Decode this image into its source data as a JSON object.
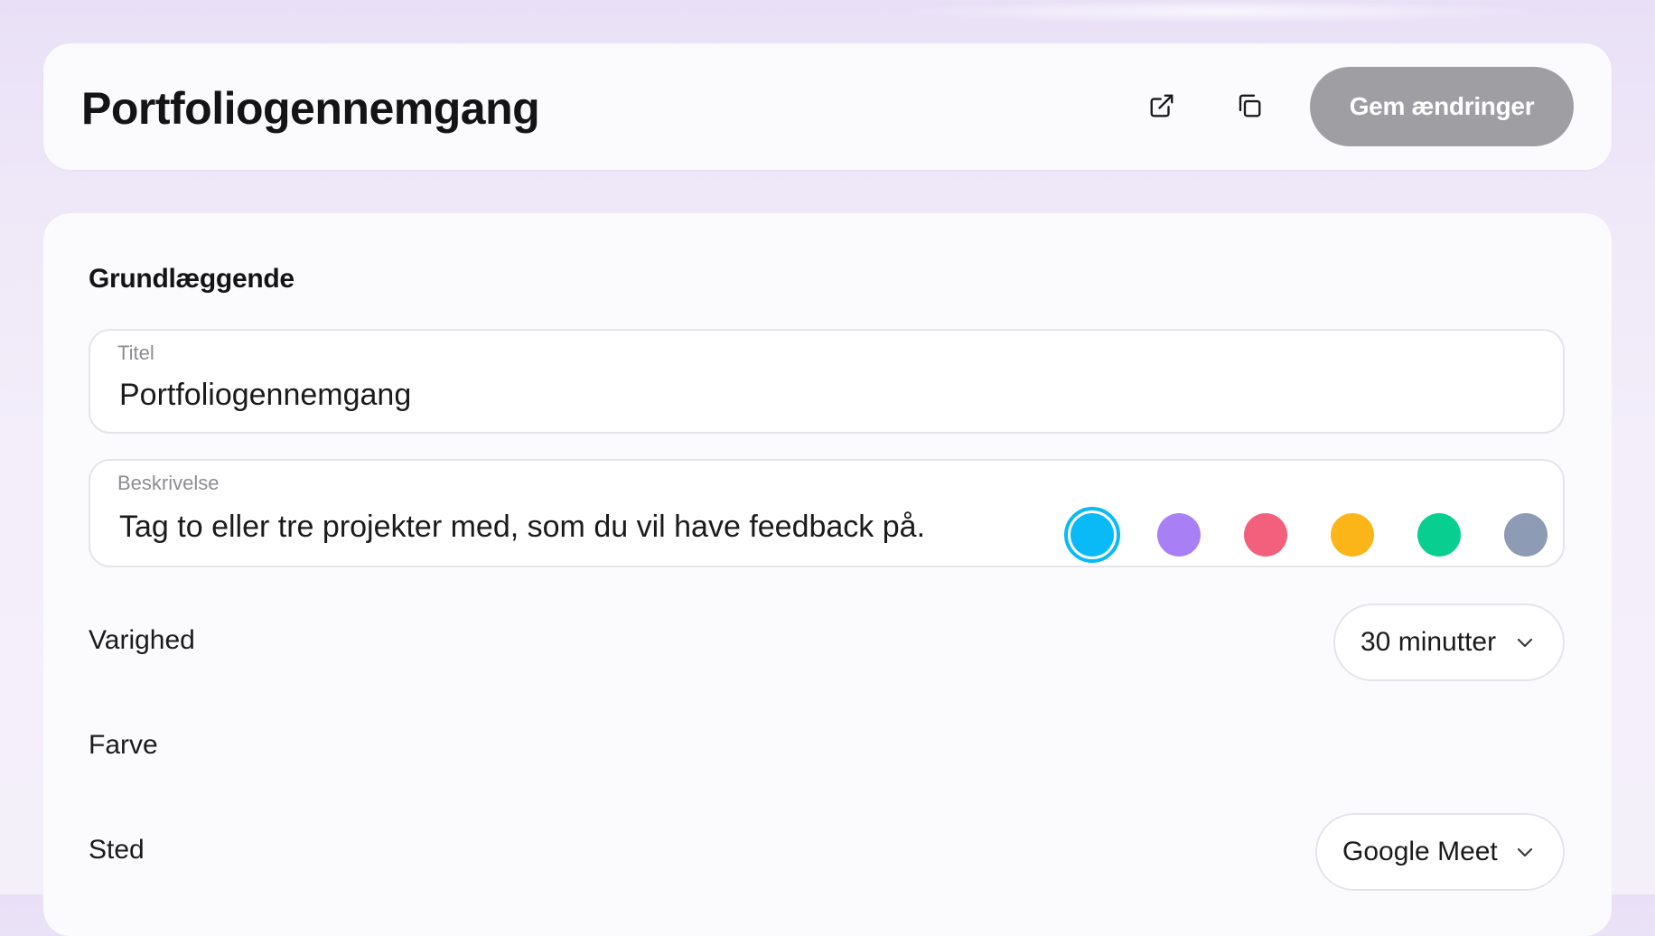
{
  "header": {
    "title": "Portfoliogennemgang",
    "open_icon": "external-link-icon",
    "copy_icon": "copy-icon",
    "save_label": "Gem ændringer"
  },
  "basics": {
    "heading": "Grundlæggende",
    "title_field": {
      "label": "Titel",
      "value": "Portfoliogennemgang"
    },
    "description_field": {
      "label": "Beskrivelse",
      "value": "Tag to eller tre projekter med, som du vil have feedback på."
    },
    "duration": {
      "label": "Varighed",
      "value": "30 minutter",
      "icon": "chevron-down-icon"
    },
    "color": {
      "label": "Farve",
      "selected_index": 0,
      "options": [
        "#0abaf7",
        "#a87ff5",
        "#f3607c",
        "#fcb518",
        "#08cf8f",
        "#8d9bb5"
      ]
    },
    "location": {
      "label": "Sted",
      "value": "Google Meet",
      "icon": "chevron-down-icon"
    }
  },
  "colors": {
    "title_text": "#141414",
    "save_button_bg": "#9f9ea3",
    "card_bg": "#fbfafd",
    "page_bg": "#efe8f8"
  }
}
